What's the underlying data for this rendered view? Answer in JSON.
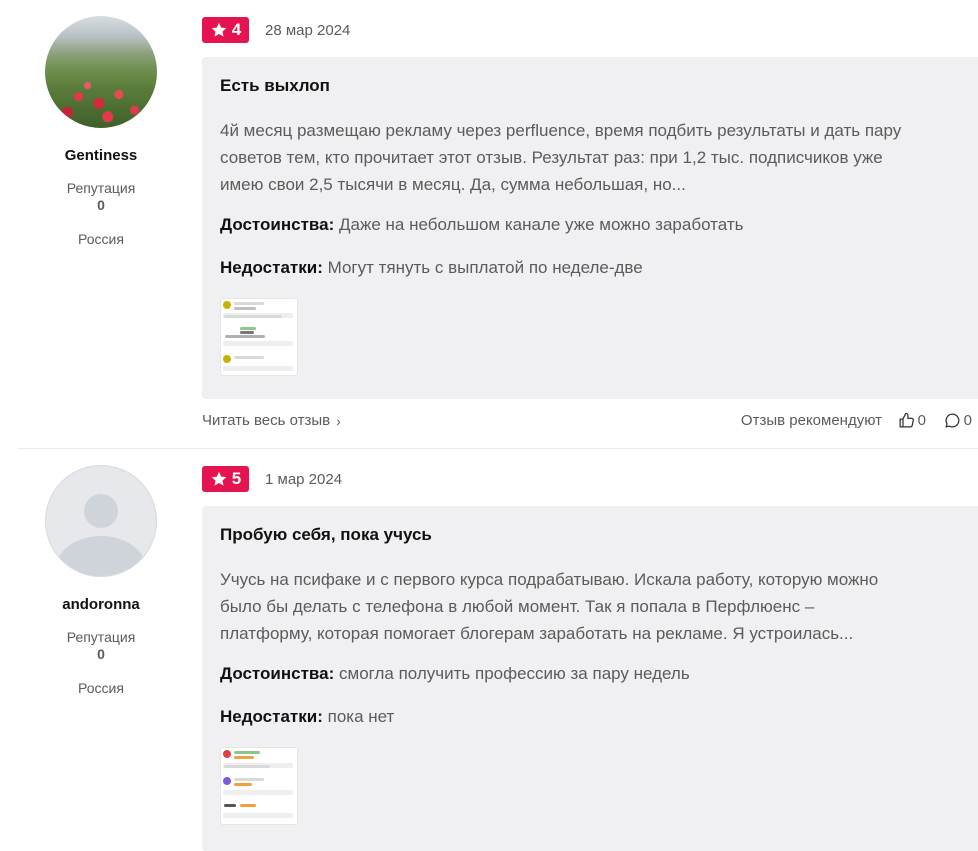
{
  "reviews": [
    {
      "author": "Gentiness",
      "reputation_label": "Репутация",
      "reputation": "0",
      "country": "Россия",
      "rating": "4",
      "date": "28 мар 2024",
      "title": "Есть выхлоп",
      "text": "4й месяц размещаю рекламу через perfluence, время подбить результаты и дать пару советов тем, кто прочитает этот отзыв. Результат раз: при 1,2 тыс. подписчиков уже имею свои 2,5 тысячи в месяц. Да, сумма небольшая, но...",
      "pros_label": "Достоинства:",
      "pros": "Даже на небольшом канале уже можно заработать",
      "cons_label": "Недостатки:",
      "cons": "Могут тянуть с выплатой по неделе-две",
      "read_more": "Читать весь отзыв",
      "recommend_label": "Отзыв рекомендуют",
      "likes": "0",
      "comments": "0"
    },
    {
      "author": "andoronna",
      "reputation_label": "Репутация",
      "reputation": "0",
      "country": "Россия",
      "rating": "5",
      "date": "1 мар 2024",
      "title": "Пробую себя, пока учусь",
      "text": "Учусь на псифаке и с первого курса подрабатываю. Искала работу, которую можно было бы делать с телефона в любой момент. Так я попала в Перфлюенс – платформу, которая помогает блогерам заработать на рекламе. Я устроилась...",
      "pros_label": "Достоинства:",
      "pros": "смогла получить профессию за пару недель",
      "cons_label": "Недостатки:",
      "cons": "пока нет"
    }
  ],
  "colors": {
    "rating_badge": "#e5134f",
    "card_bg": "#f0f0f2",
    "text_muted": "#5b5b5b"
  },
  "icons": [
    "star-icon",
    "chevron-right-icon",
    "thumbs-up-icon",
    "comment-icon"
  ]
}
